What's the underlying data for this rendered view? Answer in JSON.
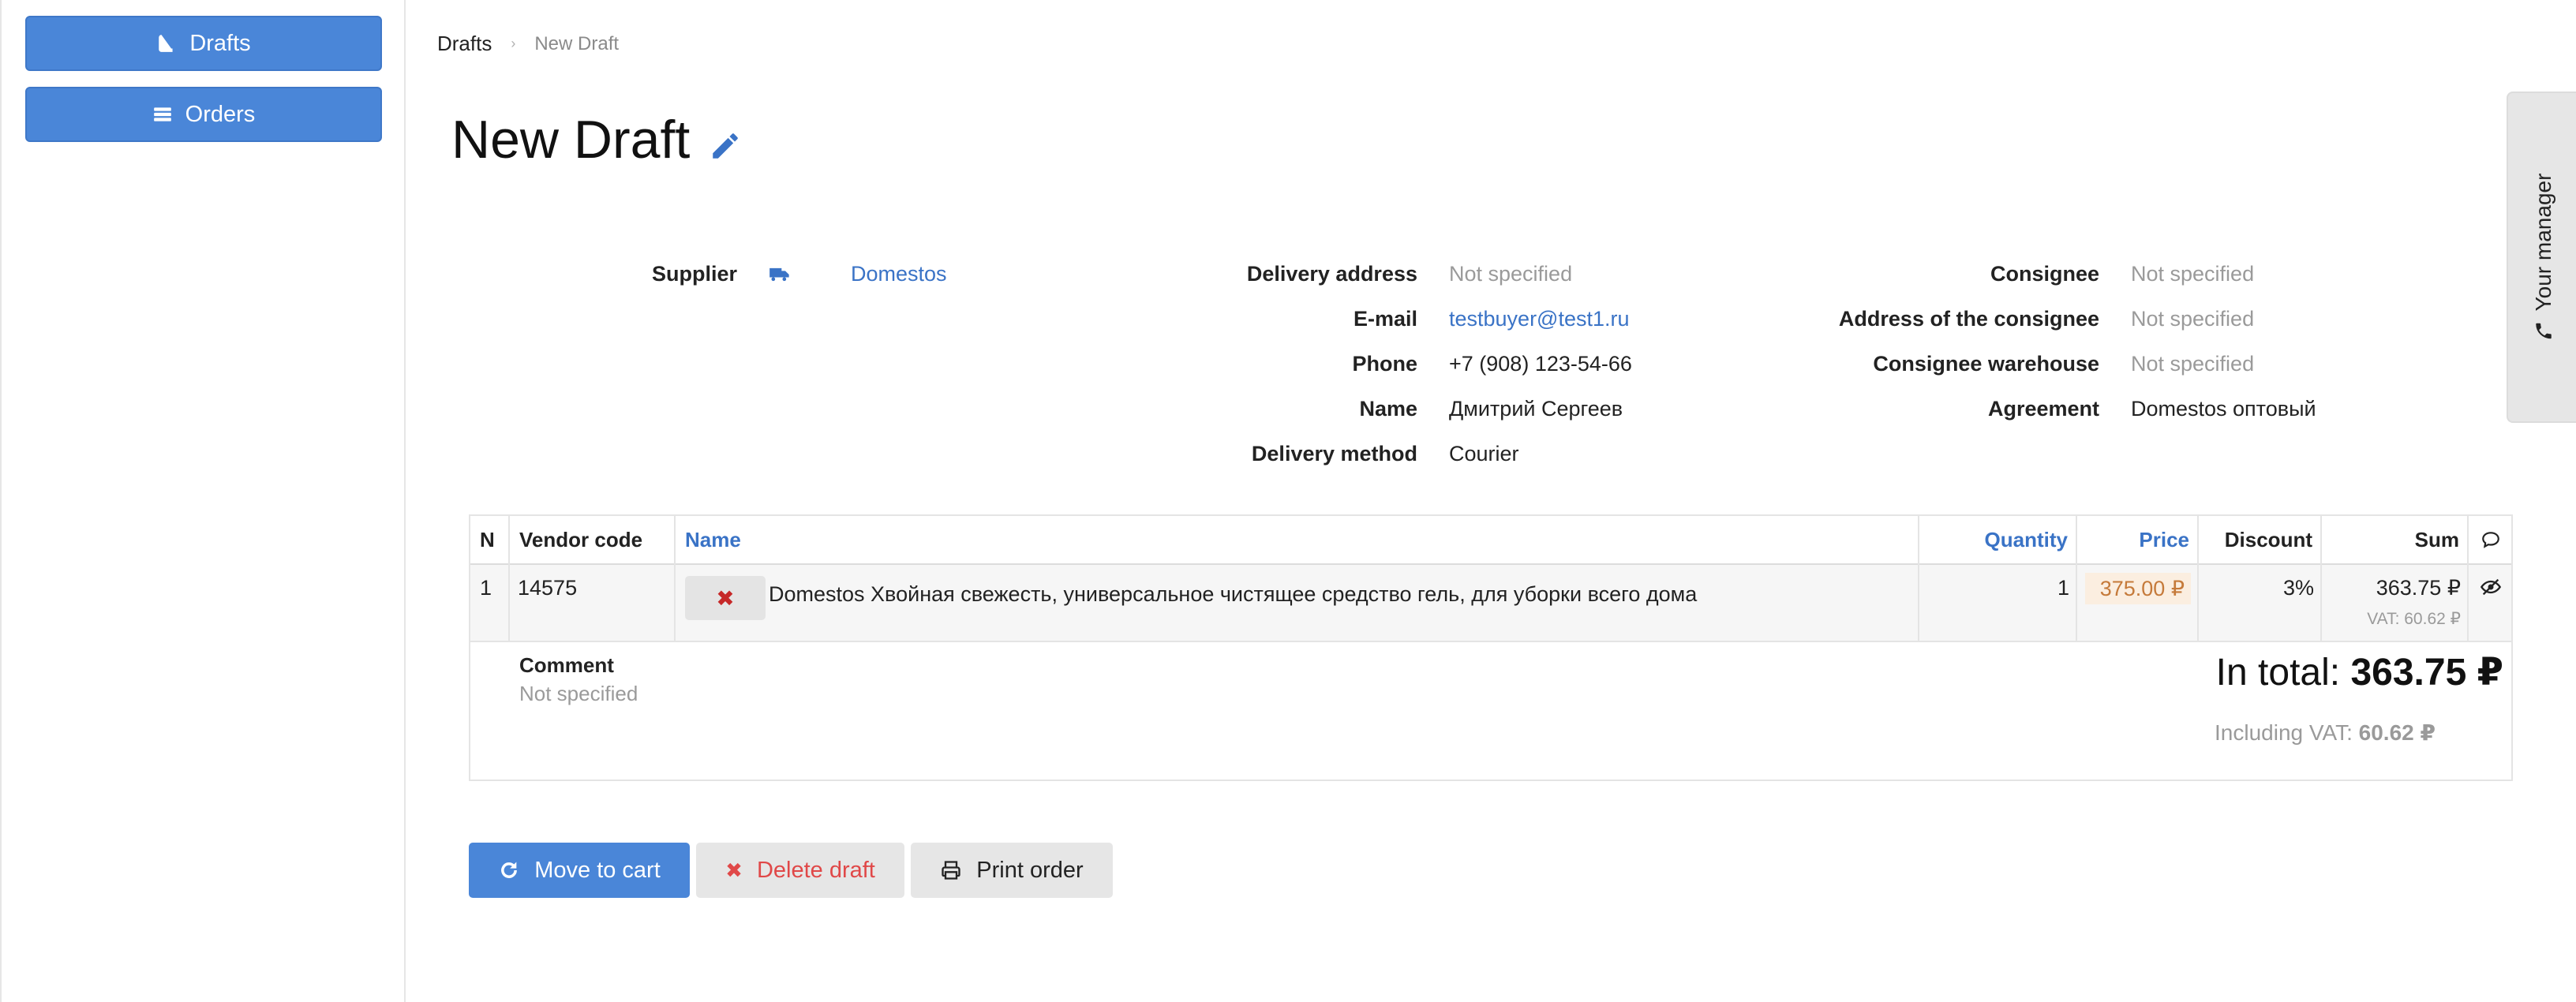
{
  "sidebar": {
    "drafts_label": "Drafts",
    "orders_label": "Orders"
  },
  "breadcrumb": {
    "root": "Drafts",
    "current": "New Draft"
  },
  "page": {
    "title": "New Draft"
  },
  "info": {
    "supplier_label": "Supplier",
    "supplier_value": "Domestos",
    "delivery_address_label": "Delivery address",
    "delivery_address_value": "Not specified",
    "email_label": "E-mail",
    "email_value": "testbuyer@test1.ru",
    "phone_label": "Phone",
    "phone_value": "+7 (908) 123-54-66",
    "name_label": "Name",
    "name_value": "Дмитрий Сергеев",
    "delivery_method_label": "Delivery method",
    "delivery_method_value": "Courier",
    "consignee_label": "Consignee",
    "consignee_value": "Not specified",
    "consignee_address_label": "Address of the consignee",
    "consignee_address_value": "Not specified",
    "consignee_warehouse_label": "Consignee warehouse",
    "consignee_warehouse_value": "Not specified",
    "agreement_label": "Agreement",
    "agreement_value": "Domestos оптовый"
  },
  "table": {
    "headers": {
      "n": "N",
      "vendor_code": "Vendor code",
      "name": "Name",
      "quantity": "Quantity",
      "price": "Price",
      "discount": "Discount",
      "sum": "Sum"
    },
    "rows": [
      {
        "n": "1",
        "vendor_code": "14575",
        "name": "Domestos Хвойная свежесть, универсальное чистящее средство гель, для уборки всего дома",
        "quantity": "1",
        "price": "375.00 ₽",
        "discount": "3%",
        "sum": "363.75 ₽",
        "vat": "VAT: 60.62 ₽"
      }
    ],
    "comment_label": "Comment",
    "comment_value": "Not specified",
    "total_prefix": "In total:",
    "total_value": "363.75 ₽",
    "vat_prefix": "Including VAT:",
    "vat_value": "60.62 ₽"
  },
  "actions": {
    "move_to_cart": "Move to cart",
    "delete_draft": "Delete draft",
    "print_order": "Print order"
  },
  "manager_tab": {
    "label": "Your manager"
  },
  "colors": {
    "accent": "#4a86d8",
    "link": "#3a73c6",
    "danger": "#e04848",
    "price_bg": "#fbeee0",
    "price_text": "#c57a3a"
  }
}
